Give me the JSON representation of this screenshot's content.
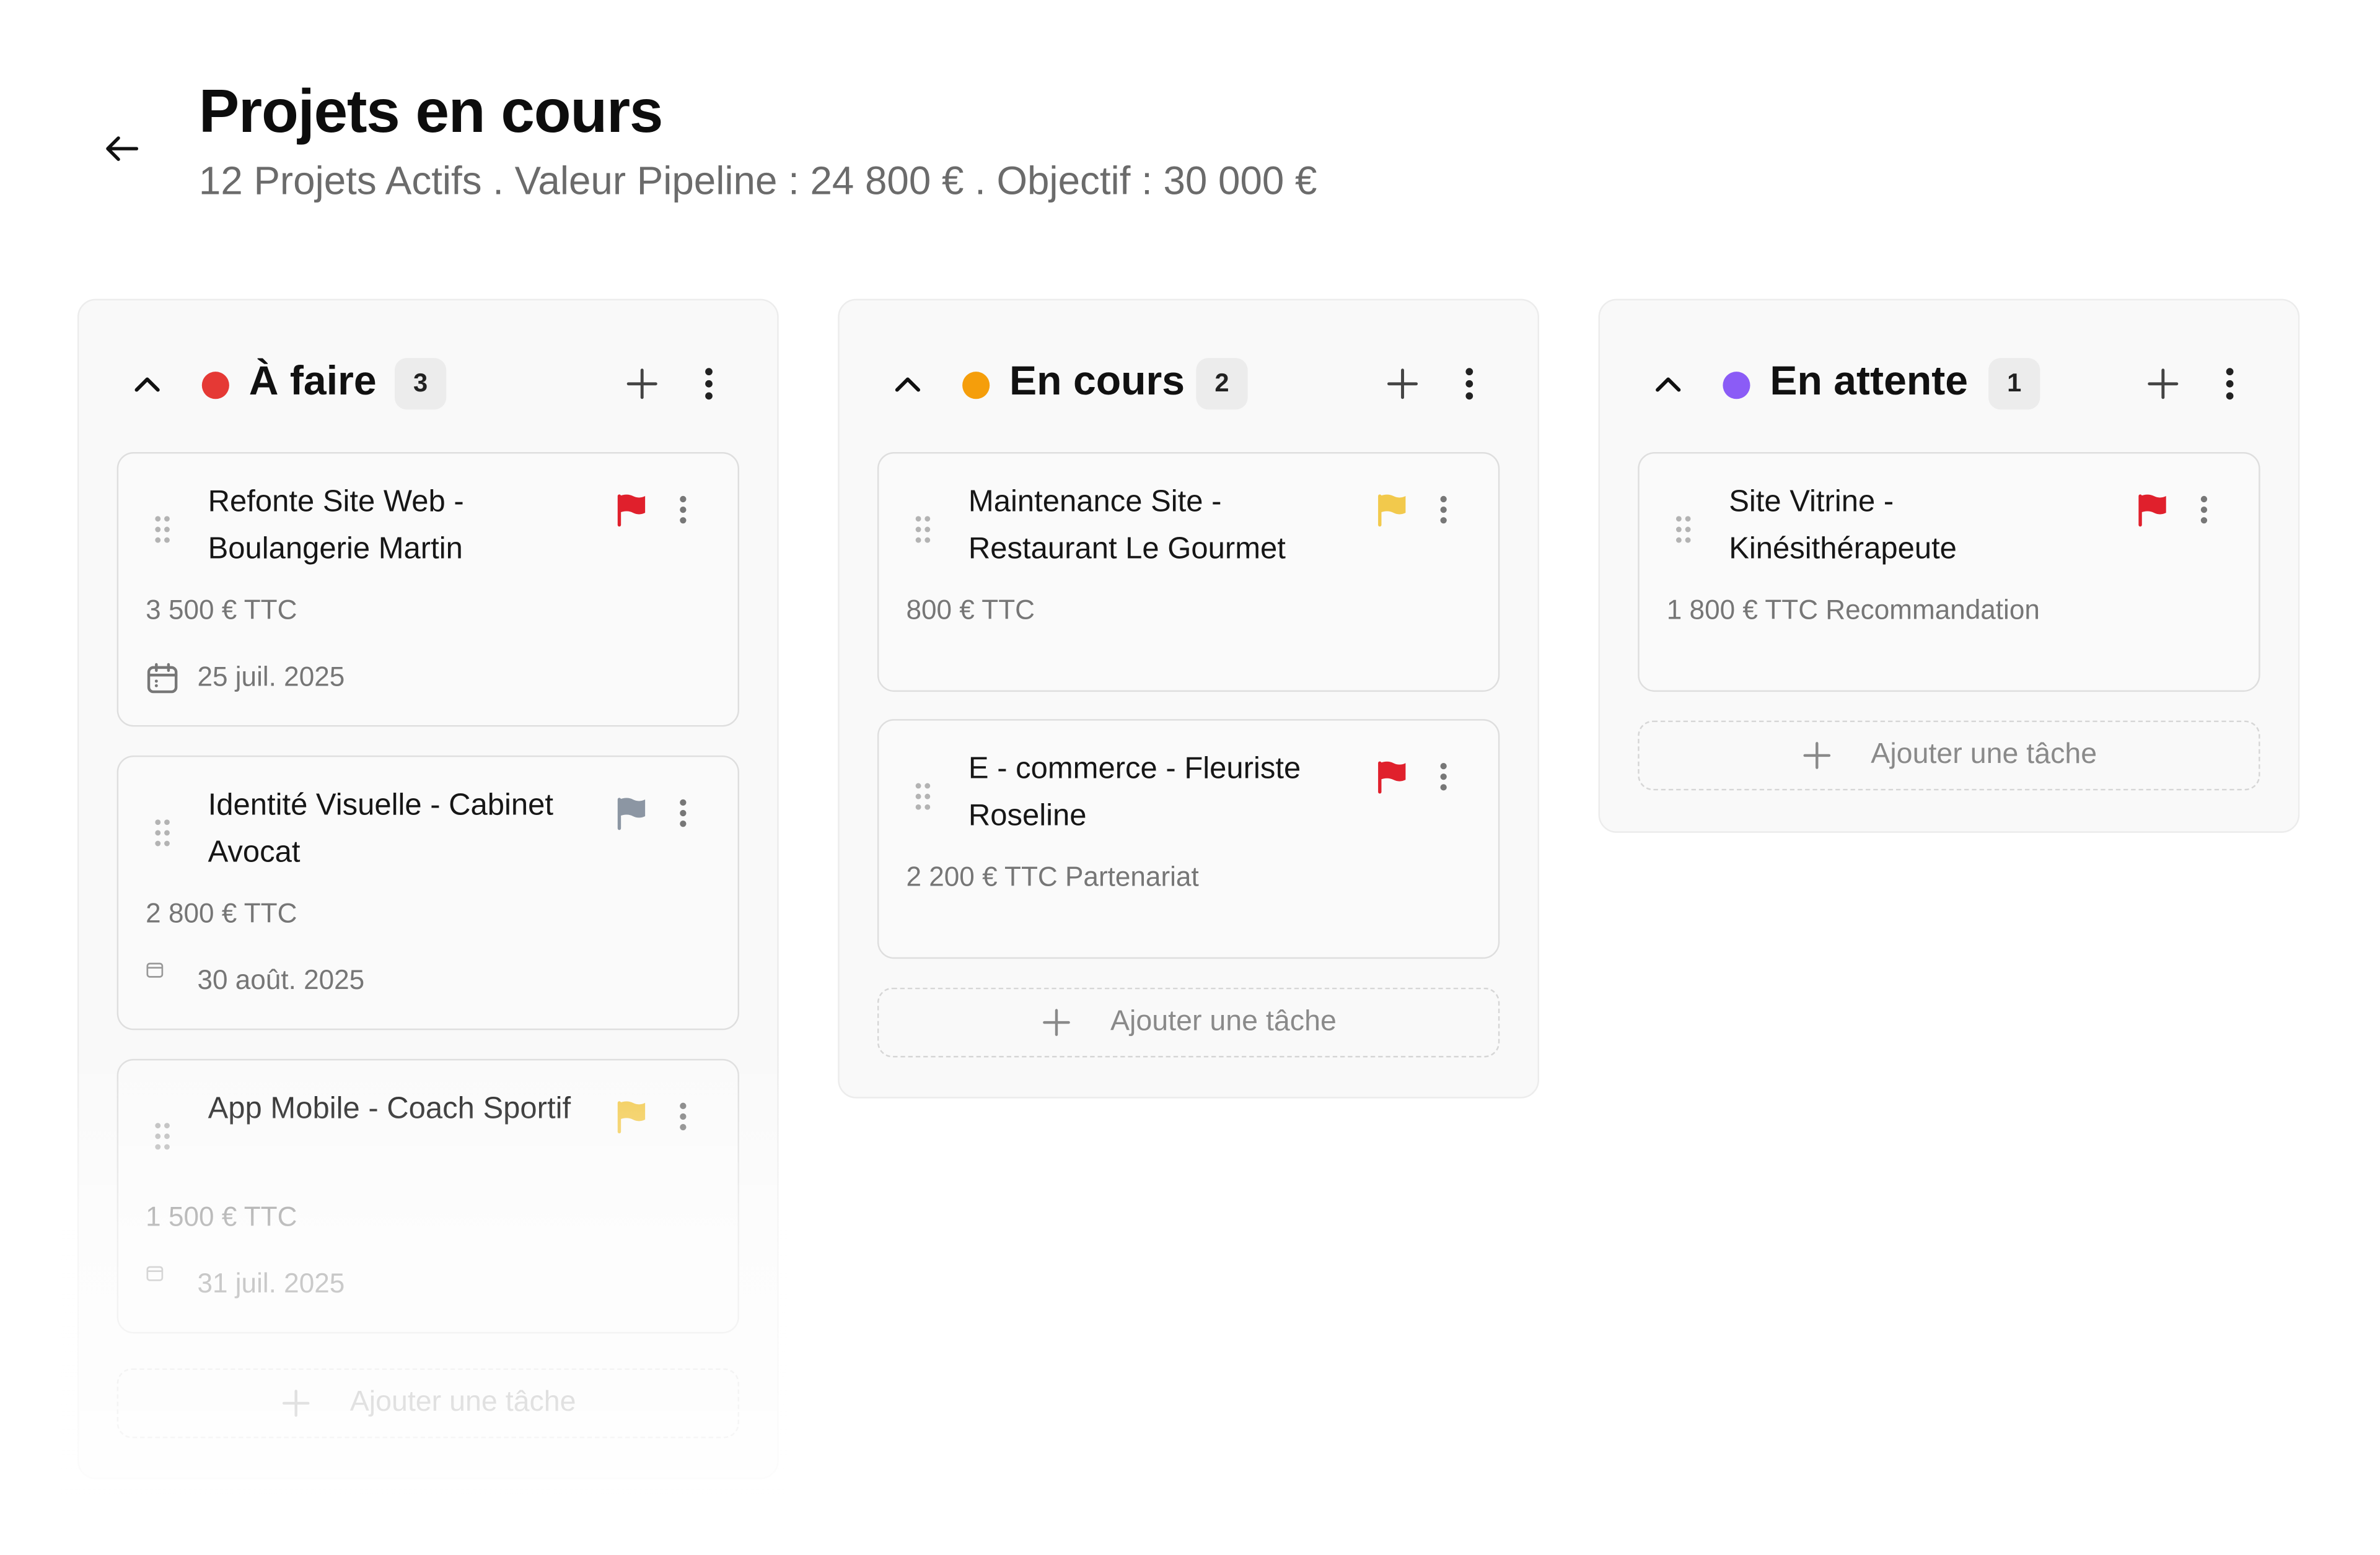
{
  "header": {
    "title": "Projets en cours",
    "subtitle": "12 Projets Actifs . Valeur Pipeline : 24 800 € . Objectif : 30 000 €"
  },
  "columns": [
    {
      "title": "À faire",
      "count": "3",
      "dot_color": "#e53935",
      "cards": [
        {
          "title": "Refonte Site Web - Boulangerie Martin",
          "price": "3 500 € TTC",
          "date": "25 juil. 2025",
          "flag_color": "#e0202c"
        },
        {
          "title": "Identité Visuelle - Cabinet Avocat",
          "price": "2 800 € TTC",
          "date": "30 août. 2025",
          "flag_color": "#8c96a3"
        },
        {
          "title": "App Mobile - Coach Sportif",
          "price": "1 500 € TTC",
          "date": "31 juil. 2025",
          "flag_color": "#f2c94c"
        }
      ],
      "add_label": "Ajouter une tâche"
    },
    {
      "title": "En cours",
      "count": "2",
      "dot_color": "#f59e0b",
      "cards": [
        {
          "title": "Maintenance Site - Restaurant Le Gourmet",
          "price": "800 € TTC",
          "flag_color": "#f2c94c"
        },
        {
          "title": "E - commerce - Fleuriste Roseline",
          "price": "2 200 € TTC Partenariat",
          "flag_color": "#e0202c"
        }
      ],
      "add_label": "Ajouter une tâche"
    },
    {
      "title": "En attente",
      "count": "1",
      "dot_color": "#8b5cf6",
      "cards": [
        {
          "title": "Site Vitrine - Kinésithérapeute",
          "price": "1 800 € TTC Recommandation",
          "flag_color": "#e0202c"
        }
      ],
      "add_label": "Ajouter une tâche"
    }
  ]
}
